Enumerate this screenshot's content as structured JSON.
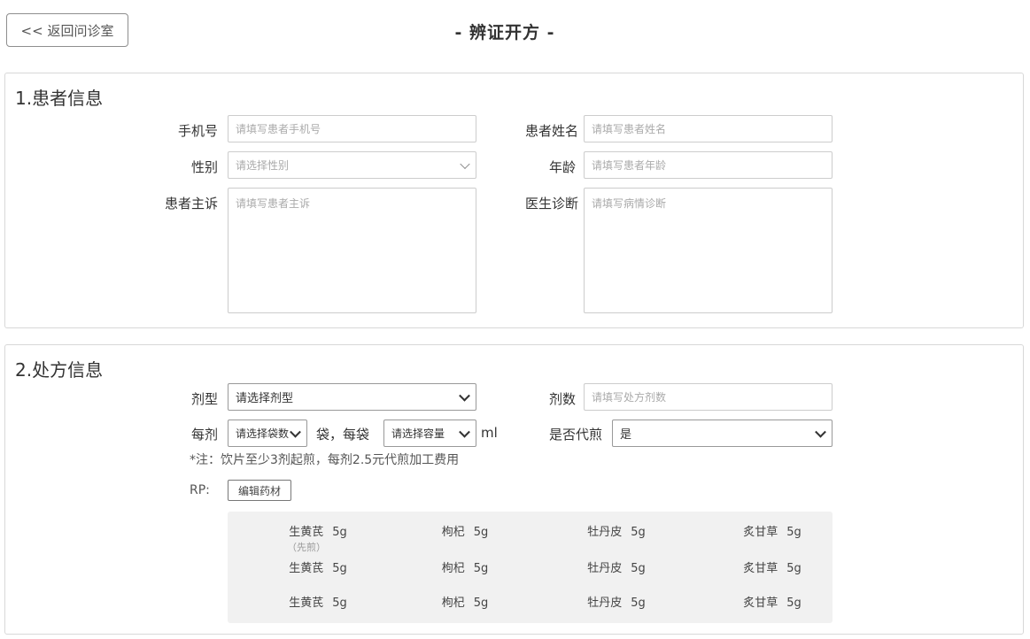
{
  "header": {
    "back_label": "<< 返回问诊室",
    "title": "- 辨证开方 -"
  },
  "patient": {
    "section_title": "1.患者信息",
    "phone_label": "手机号",
    "phone_placeholder": "请填写患者手机号",
    "name_label": "患者姓名",
    "name_placeholder": "请填写患者姓名",
    "gender_label": "性别",
    "gender_placeholder": "请选择性别",
    "age_label": "年龄",
    "age_placeholder": "请填写患者年龄",
    "complaint_label": "患者主诉",
    "complaint_placeholder": "请填写患者主诉",
    "diagnosis_label": "医生诊断",
    "diagnosis_placeholder": "请填写病情诊断"
  },
  "prescription": {
    "section_title": "2.处方信息",
    "form_label": "剂型",
    "form_value": "请选择剂型",
    "count_label": "剂数",
    "count_placeholder": "请填写处方剂数",
    "per_label": "每剂",
    "bag_value": "请选择袋数",
    "bag_unit": "袋，每袋",
    "volume_value": "请选择容量",
    "volume_unit": "ml",
    "decoct_label": "是否代煎",
    "decoct_value": "是",
    "note": "*注：饮片至少3剂起煎，每剂2.5元代煎加工费用",
    "rp_label": "RP:",
    "edit_label": "编辑药材",
    "herbs": [
      [
        {
          "name": "生黄芪",
          "dose": "5g",
          "sub": "（先煎）"
        },
        {
          "name": "枸杞",
          "dose": "5g"
        },
        {
          "name": "牡丹皮",
          "dose": "5g"
        },
        {
          "name": "炙甘草",
          "dose": "5g"
        }
      ],
      [
        {
          "name": "生黄芪",
          "dose": "5g"
        },
        {
          "name": "枸杞",
          "dose": "5g"
        },
        {
          "name": "牡丹皮",
          "dose": "5g"
        },
        {
          "name": "炙甘草",
          "dose": "5g"
        }
      ],
      [
        {
          "name": "生黄芪",
          "dose": "5g"
        },
        {
          "name": "枸杞",
          "dose": "5g"
        },
        {
          "name": "牡丹皮",
          "dose": "5g"
        },
        {
          "name": "炙甘草",
          "dose": "5g"
        }
      ]
    ]
  }
}
